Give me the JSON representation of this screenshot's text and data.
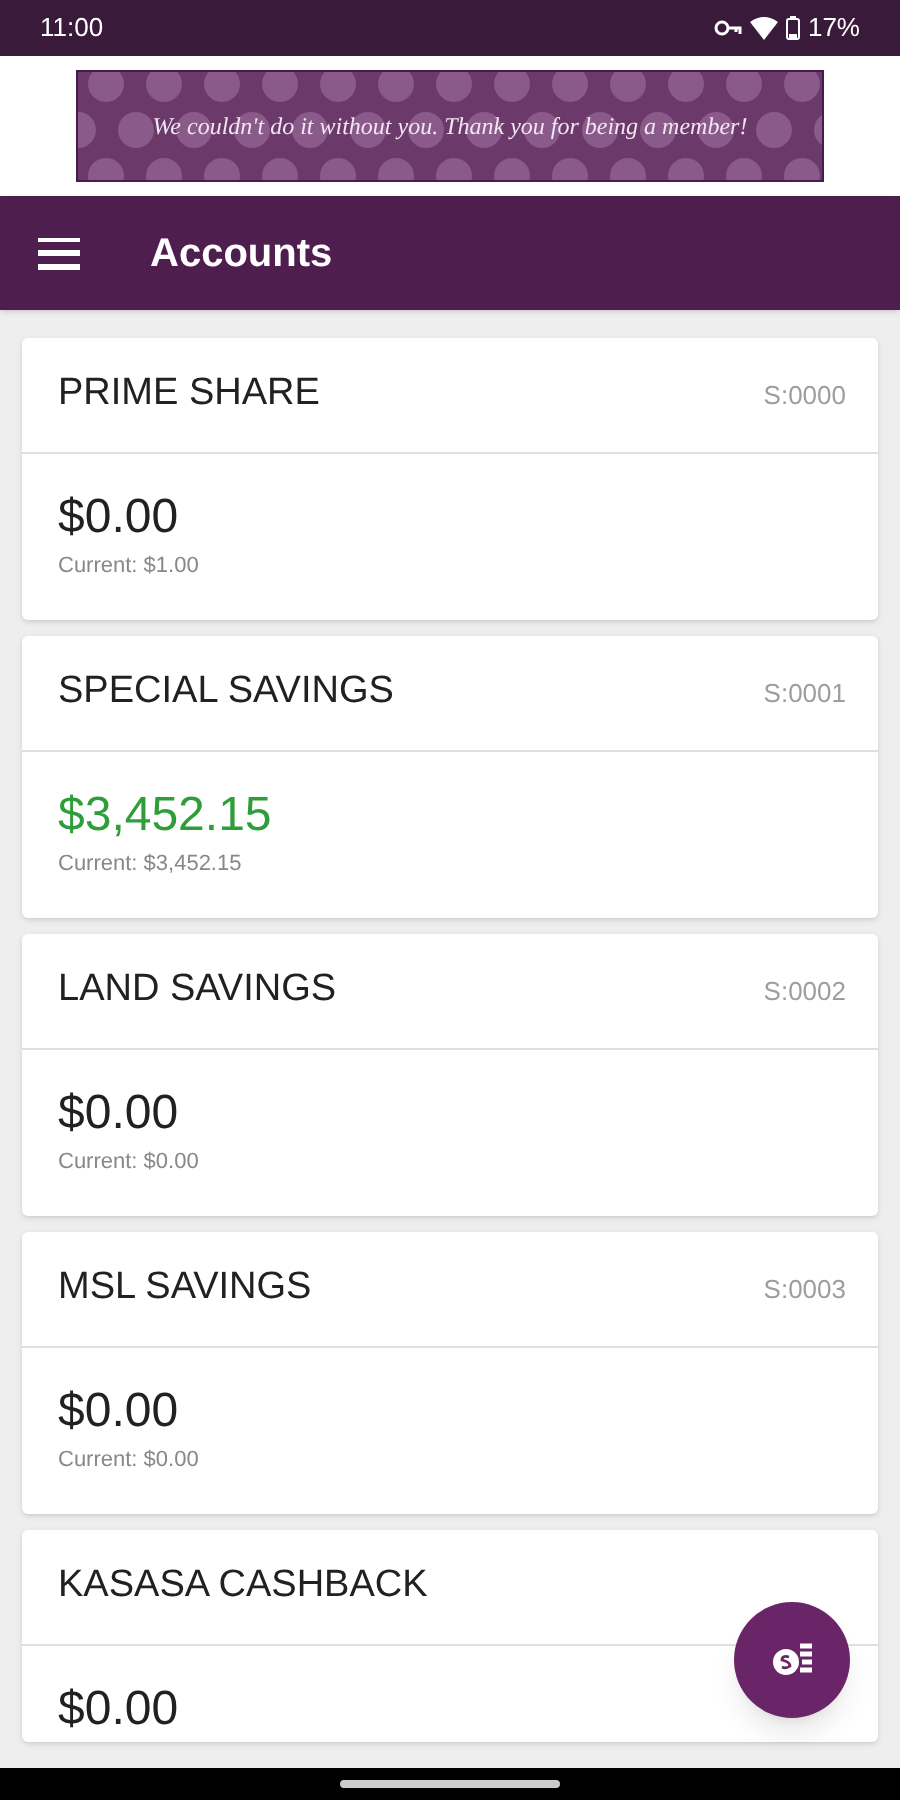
{
  "status_bar": {
    "time": "11:00",
    "battery": "17%"
  },
  "banner": {
    "text": "We couldn't do it without you. Thank you for being a member!"
  },
  "app_bar": {
    "title": "Accounts"
  },
  "accounts": [
    {
      "name": "PRIME SHARE",
      "id": "S:0000",
      "balance": "$0.00",
      "current": "Current: $1.00",
      "color": "#212121"
    },
    {
      "name": "SPECIAL SAVINGS",
      "id": "S:0001",
      "balance": "$3,452.15",
      "current": "Current: $3,452.15",
      "color": "#2e9e3a"
    },
    {
      "name": "LAND SAVINGS",
      "id": "S:0002",
      "balance": "$0.00",
      "current": "Current: $0.00",
      "color": "#212121"
    },
    {
      "name": "MSL SAVINGS",
      "id": "S:0003",
      "balance": "$0.00",
      "current": "Current: $0.00",
      "color": "#212121"
    },
    {
      "name": "KASASA CASHBACK",
      "balance": "$0.00",
      "color": "#212121"
    }
  ]
}
